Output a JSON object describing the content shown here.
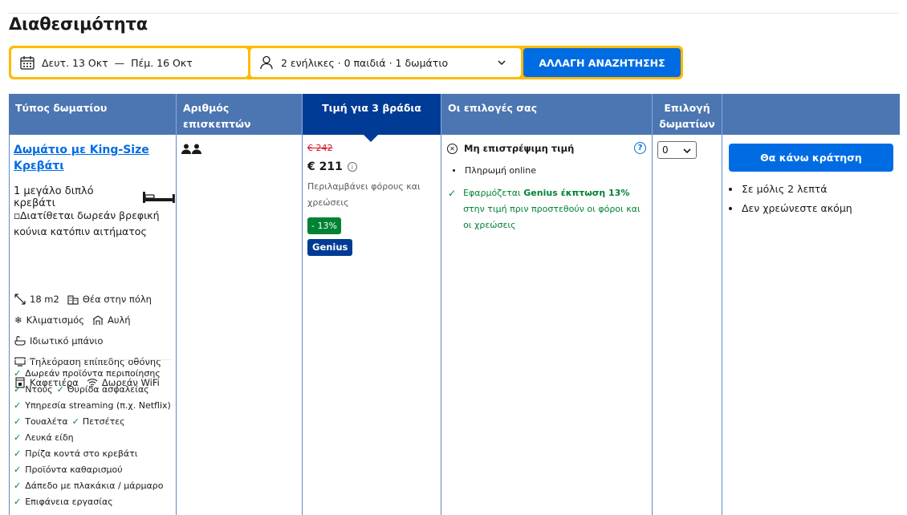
{
  "page": {
    "title": "Διαθεσιμότητα"
  },
  "search": {
    "checkin": "Δευτ. 13 Οκτ",
    "dash": "—",
    "checkout": "Πέμ. 16 Οκτ",
    "guests": "2 ενήλικες · 0 παιδιά · 1 δωμάτιο",
    "button": "ΑΛΛΑΓΗ ΑΝΑΖΗΤΗΣΗΣ"
  },
  "columns": {
    "room_type": "Τύπος δωματίου",
    "guests": "Αριθμός επισκεπτών",
    "price": "Τιμή για 3 βράδια",
    "choices": "Οι επιλογές σας",
    "select": "Επιλογή δωματίων"
  },
  "room": {
    "name": "Δωμάτιο με King-Size Κρεβάτι",
    "bed": "1 μεγάλο διπλό κρεβάτι",
    "crib": "Διατίθεται δωρεάν βρεφική κούνια κατόπιν αιτήματος",
    "facilities": {
      "size": "18 m2",
      "city_view": "Θέα στην πόλη",
      "ac": "Κλιματισμός",
      "patio": "Αυλή",
      "bathroom": "Ιδιωτικό μπάνιο",
      "tv": "Τηλεόραση επίπεδης οθόνης",
      "coffee": "Καφετιέρα",
      "wifi": "Δωρεάν WiFi"
    },
    "amenities": {
      "toiletries": "Δωρεάν προϊόντα περιποίησης",
      "shower": "Ντους",
      "safe": "Θυρίδα ασφαλείας",
      "streaming": "Υπηρεσία streaming (π.χ. Netflix)",
      "toilet": "Τουαλέτα",
      "towels": "Πετσέτες",
      "linen": "Λευκά είδη",
      "socket": "Πρίζα κοντά στο κρεβάτι",
      "cleaning": "Προϊόντα καθαρισμού",
      "floor": "Δάπεδο με πλακάκια / μάρμαρο",
      "desk": "Επιφάνεια εργασίας"
    }
  },
  "pricing": {
    "old": "€ 242",
    "current": "€ 211",
    "info_icon": "i",
    "taxes": "Περιλαμβάνει φόρους και χρεώσεις",
    "discount": "- 13%",
    "genius": "Genius"
  },
  "choices": {
    "non_refundable": "Μη επιστρέψιμη τιμή",
    "help_icon": "?",
    "payment": "Πληρωμή online",
    "genius_prefix": "Εφαρμόζεται ",
    "genius_bold": "Genius έκπτωση 13%",
    "genius_suffix": " στην τιμή πριν προστεθούν οι φόροι και οι χρεώσεις"
  },
  "select": {
    "value": "0"
  },
  "booking": {
    "button": "Θα κάνω κράτηση",
    "note1": "Σε μόλις 2 λεπτά",
    "note2": "Δεν χρεώνεστε ακόμη"
  },
  "colors": {
    "primary": "#006ce4",
    "header": "#4c76b2",
    "active_header": "#003b95",
    "yellow": "#febb02",
    "green": "#008234",
    "red": "#d4111e"
  }
}
